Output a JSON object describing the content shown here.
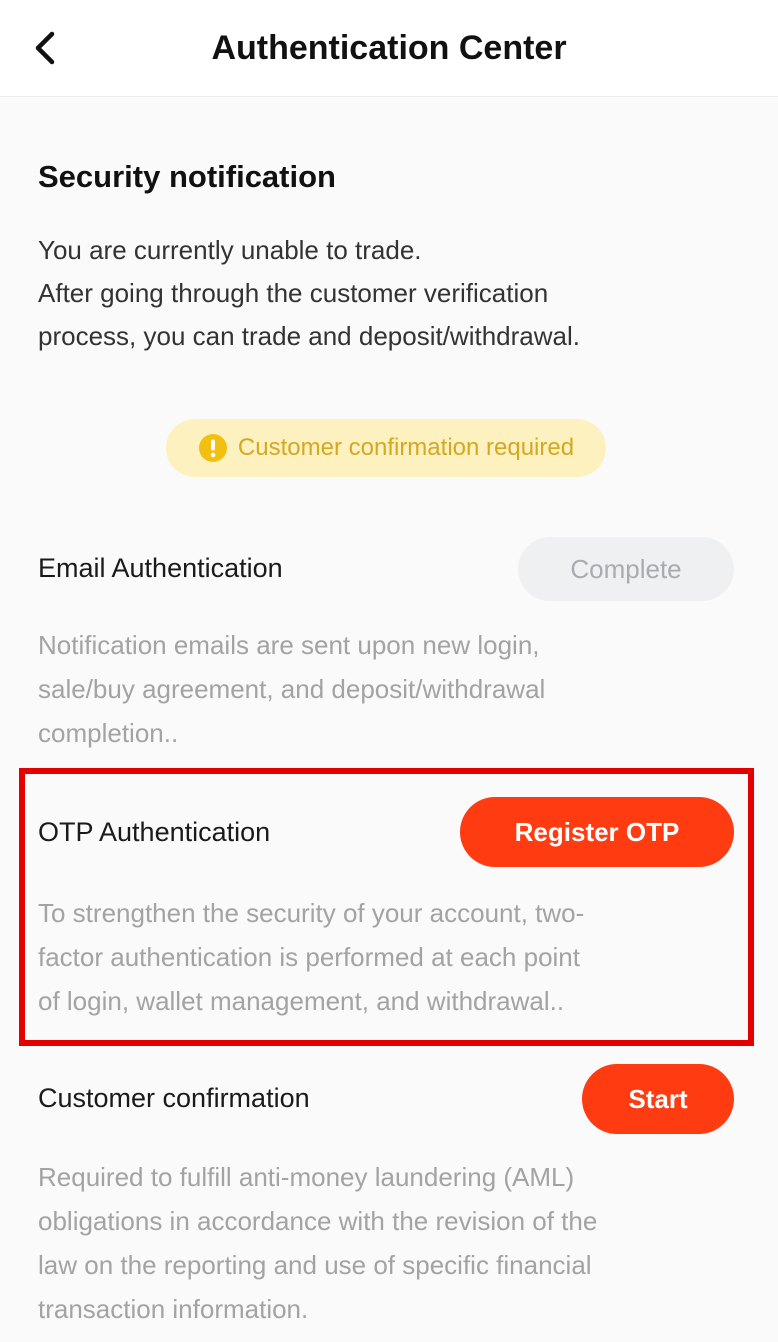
{
  "header": {
    "title": "Authentication Center",
    "back_icon": "chevron-left-icon"
  },
  "security": {
    "title": "Security notification",
    "lines": [
      "You are currently unable to trade.",
      "After going through the customer verification",
      "process, you can trade and deposit/withdrawal."
    ],
    "badge_icon": "exclamation-circle-icon",
    "badge_text": "Customer confirmation required"
  },
  "email_auth": {
    "title": "Email Authentication",
    "button_label": "Complete",
    "desc_lines": [
      "Notification emails are sent upon new login,",
      "sale/buy agreement, and deposit/withdrawal",
      "completion.."
    ]
  },
  "otp_auth": {
    "title": "OTP Authentication",
    "button_label": "Register  OTP",
    "desc_lines": [
      "To strengthen the security of your account, two-",
      "factor authentication is performed at each point",
      "of login, wallet management, and withdrawal.."
    ]
  },
  "customer_confirmation": {
    "title": "Customer confirmation",
    "button_label": "Start",
    "desc_lines": [
      "Required to fulfill anti-money laundering (AML)",
      "obligations in accordance with the revision of the",
      "law on the reporting and use of specific financial",
      "transaction information."
    ]
  },
  "colors": {
    "accent": "#ff3b12",
    "badge_bg": "#fdf1bf",
    "badge_text": "#d4a820",
    "highlight": "#e40000",
    "complete_bg": "#eef0f2"
  }
}
